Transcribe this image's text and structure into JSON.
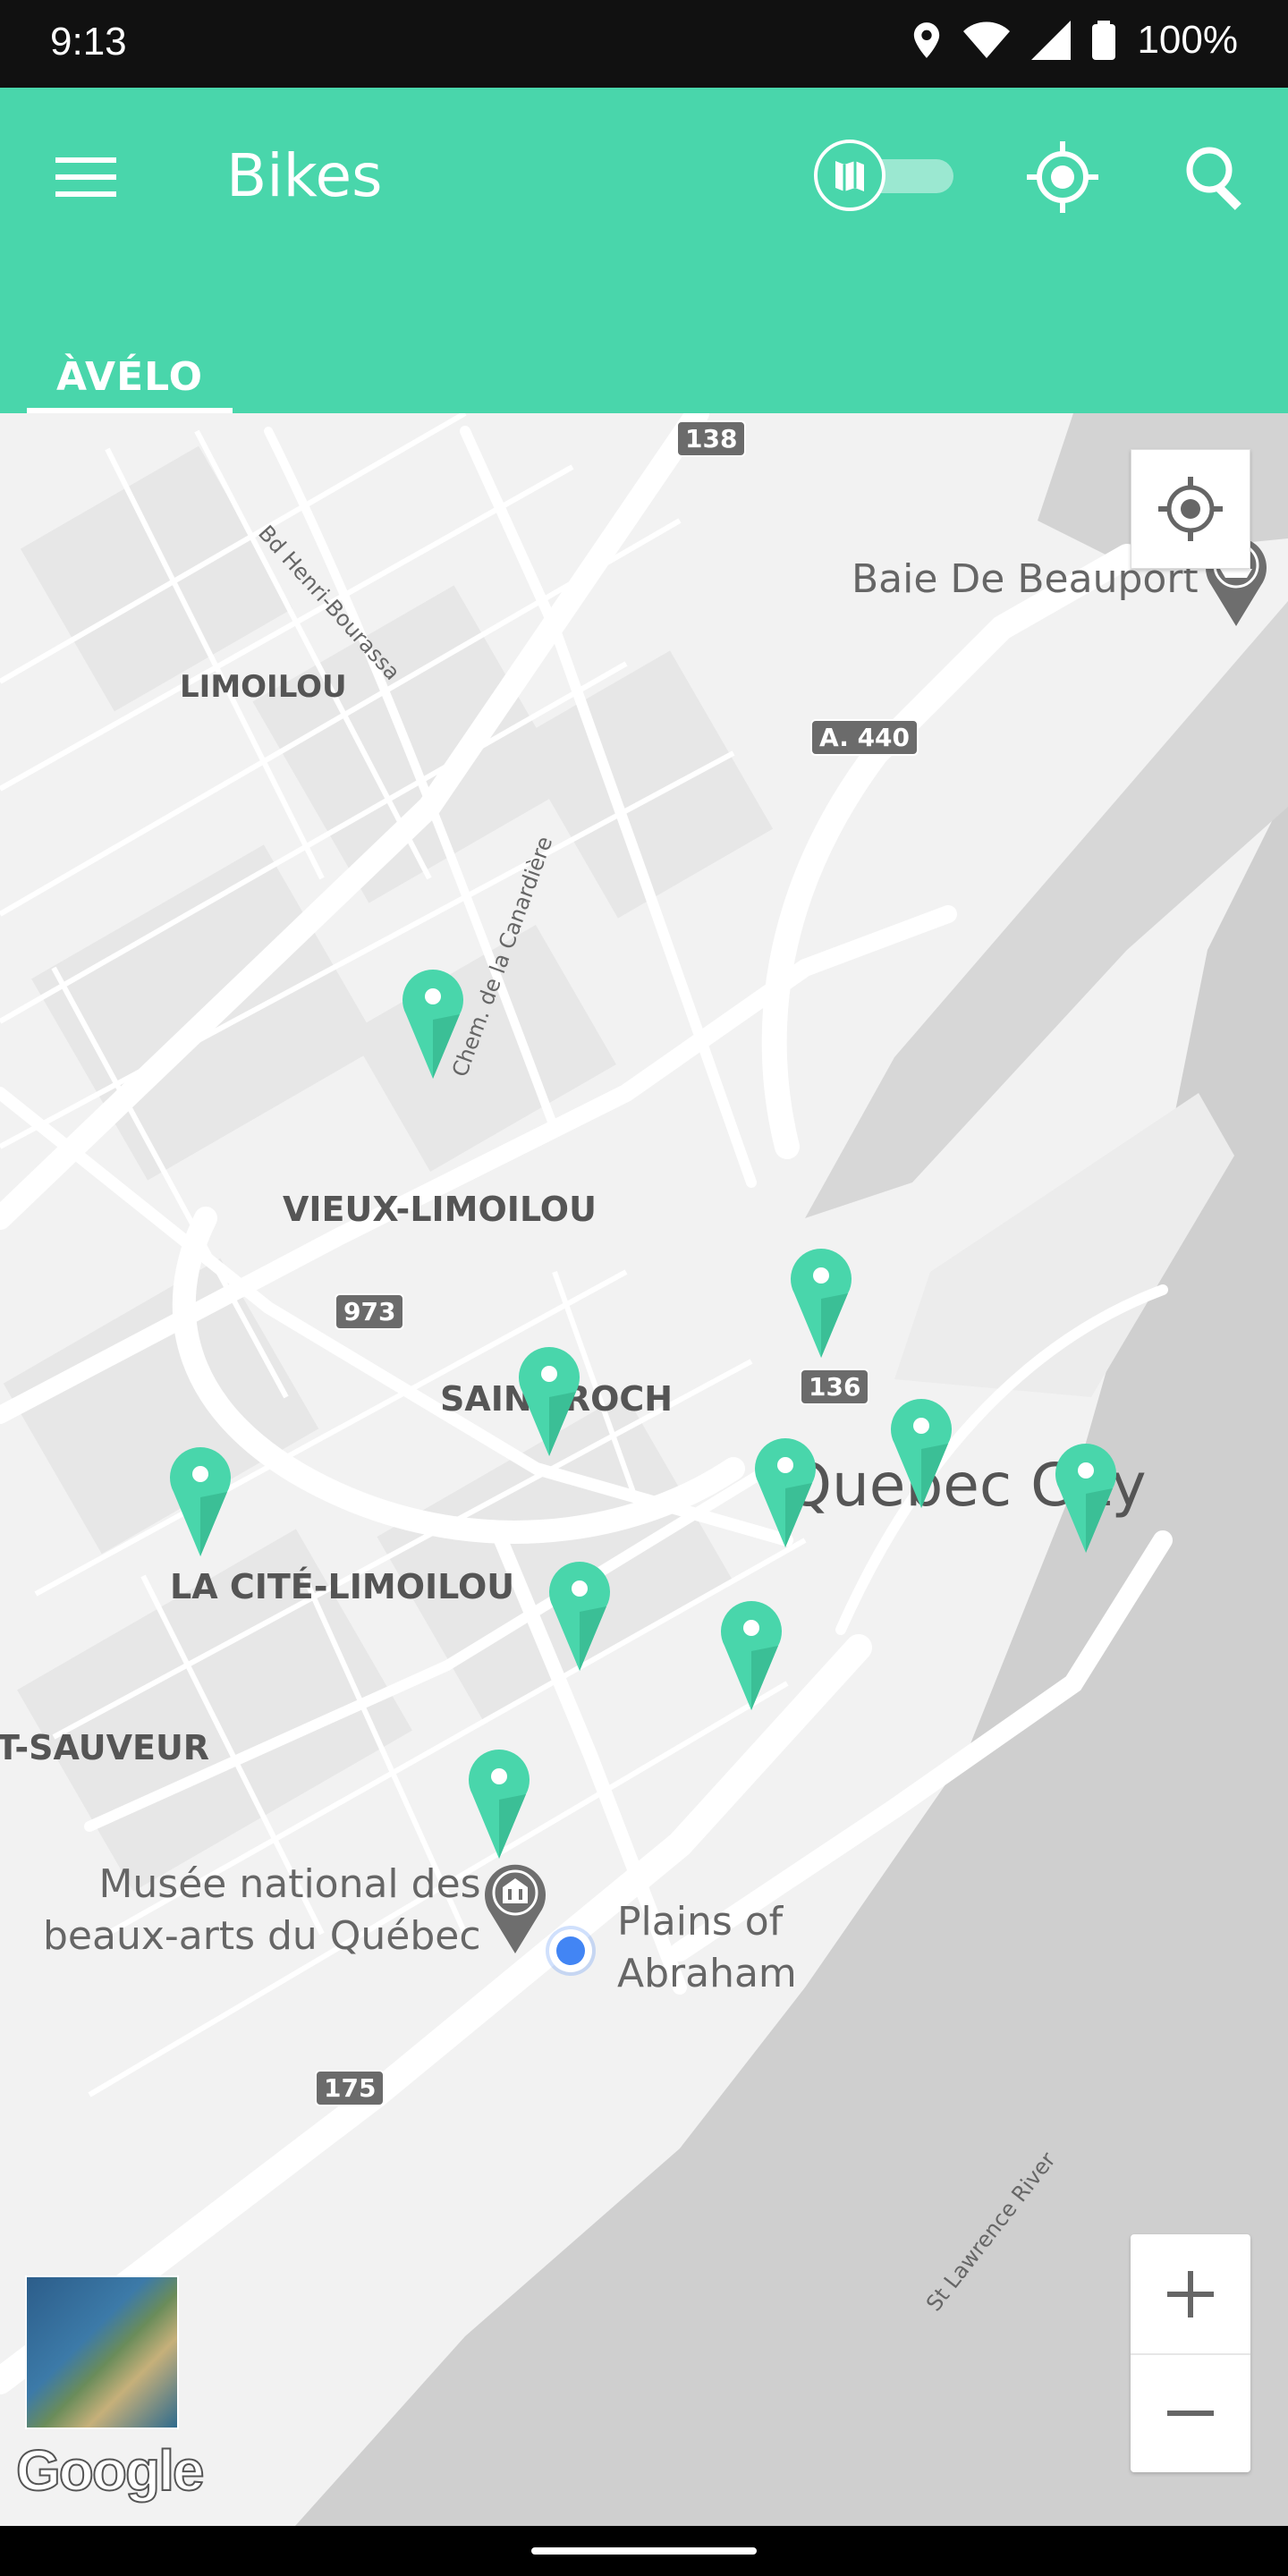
{
  "status_bar": {
    "time": "9:13",
    "battery": "100%"
  },
  "appbar": {
    "title": "Bikes",
    "accent": "#49d6ab"
  },
  "tabs": [
    {
      "label": "ÀVÉLO",
      "selected": true
    }
  ],
  "map": {
    "labels": {
      "limoilou": "LIMOILOU",
      "vieux_limoilou": "VIEUX-LIMOILOU",
      "saint_roch": "SAINT-ROCH",
      "la_cite_limoilou": "LA CITÉ-LIMOILOU",
      "saint_sauveur": "T-SAUVEUR",
      "quebec_city": "Quebec City",
      "baie_de_beauport": "Baie De Beauport",
      "musee_line1": "Musée national des",
      "musee_line2": "beaux-arts du Québec",
      "plains_line1": "Plains of",
      "plains_line2": "Abraham",
      "bd_henri_bourassa": "Bd Henri-Bourassa",
      "chem_canardiere": "Chem. de la Canardière",
      "st_lawrence": "St Lawrence River"
    },
    "shields": {
      "r138": "138",
      "a440": "A. 440",
      "r973": "973",
      "r136": "136",
      "r175": "175"
    },
    "pin_color": "#49d6ab",
    "attribution": "Google"
  }
}
